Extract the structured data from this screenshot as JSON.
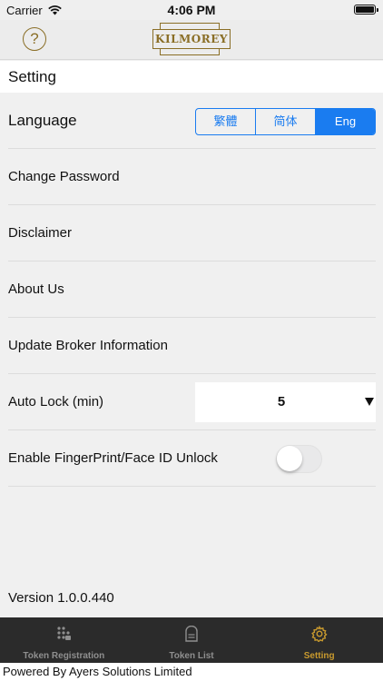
{
  "status_bar": {
    "carrier": "Carrier",
    "time": "4:06 PM"
  },
  "header": {
    "help": "?",
    "logo_text": "KILMOREY"
  },
  "section_title": "Setting",
  "settings": {
    "language_label": "Language",
    "language_options": [
      "繁體",
      "简体",
      "Eng"
    ],
    "language_selected": "Eng",
    "change_password": "Change Password",
    "disclaimer": "Disclaimer",
    "about_us": "About Us",
    "update_broker": "Update Broker Information",
    "auto_lock_label": "Auto Lock (min)",
    "auto_lock_value": "5",
    "biometric_label": "Enable FingerPrint/Face ID Unlock",
    "biometric_enabled": false
  },
  "version": "Version 1.0.0.440",
  "tabs": [
    {
      "label": "Token Registration",
      "icon": "keypad-icon",
      "active": false
    },
    {
      "label": "Token List",
      "icon": "token-icon",
      "active": false
    },
    {
      "label": "Setting",
      "icon": "gear-icon",
      "active": true
    }
  ],
  "footer": "Powered By Ayers Solutions Limited",
  "colors": {
    "accent": "#1a7cf0",
    "brand_gold": "#8a6e26",
    "active_tab": "#c99a2e",
    "tab_bg": "#2b2b2b"
  }
}
